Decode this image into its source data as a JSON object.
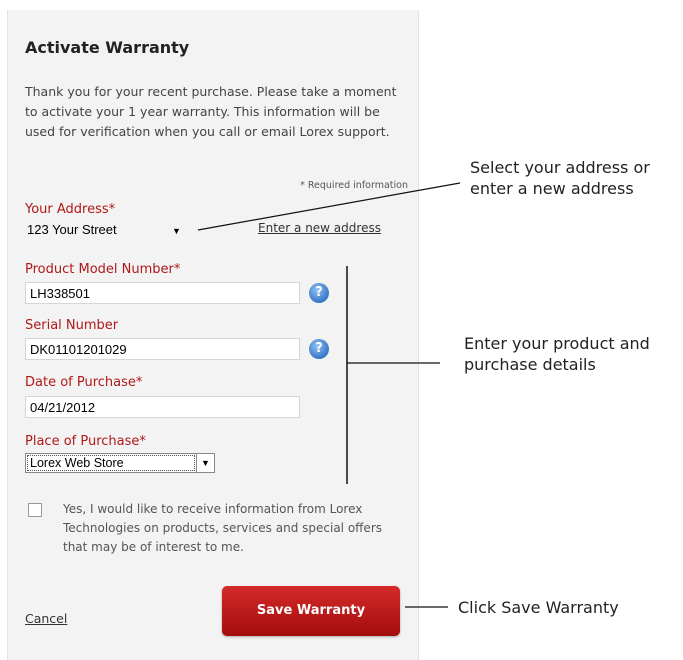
{
  "form": {
    "title": "Activate Warranty",
    "intro": "Thank you for your recent purchase. Please take a moment to activate your 1 year warranty. This information will be used for verification when you call or email Lorex support.",
    "required_note": "* Required information",
    "address": {
      "label": "Your Address*",
      "value": "123 Your Street",
      "new_link": "Enter a new address"
    },
    "model": {
      "label": "Product Model Number*",
      "value": "LH338501"
    },
    "serial": {
      "label": "Serial Number",
      "value": "DK01101201029"
    },
    "date": {
      "label": "Date of Purchase*",
      "value": "04/21/2012"
    },
    "place": {
      "label": "Place of Purchase*",
      "value": "Lorex Web Store"
    },
    "consent": "Yes, I would like to receive information from Lorex Technologies on products, services and special offers that may be of interest to me.",
    "cancel": "Cancel",
    "save": "Save Warranty"
  },
  "callouts": {
    "address_line1": "Select your address or",
    "address_line2": "enter a new address",
    "details_line1": "Enter your product and",
    "details_line2": "purchase details",
    "save": "Click Save Warranty"
  },
  "icons": {
    "help": "question-circle-icon",
    "dropdown": "chevron-down-icon"
  },
  "colors": {
    "label": "#b01818",
    "button": "#c41a1a",
    "help": "#3776c6"
  }
}
